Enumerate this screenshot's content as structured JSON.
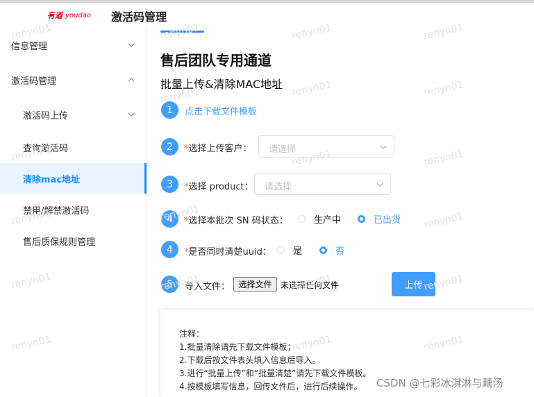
{
  "header": {
    "logo_cn": "有道",
    "logo_en": "youdao",
    "app_title": "激活码管理"
  },
  "sidebar": {
    "items": [
      {
        "label": "信息管理",
        "chevron": "down"
      },
      {
        "label": "激活码管理",
        "chevron": "up"
      },
      {
        "label": "激活码上传",
        "chevron": "down"
      },
      {
        "label": "查询激活码"
      },
      {
        "label": "清除mac地址",
        "active": true
      },
      {
        "label": "禁用/解禁激活码"
      },
      {
        "label": "售后质保规则管理"
      }
    ]
  },
  "main": {
    "title": "售后团队专用通道",
    "subtitle": "批量上传&清除MAC地址",
    "steps": [
      {
        "num": "1",
        "link": "点击下载文件模板"
      },
      {
        "num": "2",
        "req": "*",
        "label": "选择上传客户：",
        "placeholder": "请选择"
      },
      {
        "num": "3",
        "req": "*",
        "label": "选择 product：",
        "placeholder": "请选择"
      },
      {
        "num": "4",
        "req": "*",
        "label": "选择本批次 SN 码状态：",
        "options": [
          "生产中",
          "已出货"
        ],
        "selected": "已出货"
      },
      {
        "num": "4",
        "req": "*",
        "label": "是否同时清楚uuid：",
        "options": [
          "是",
          "否"
        ],
        "selected": "否"
      },
      {
        "num": "5",
        "label": "导入文件：",
        "file_button": "选择文件",
        "file_status": "未选择任何文件",
        "upload_label": "上传"
      }
    ],
    "notes": {
      "title": "注释：",
      "lines": [
        "1.批量清除请先下载文件模板；",
        "2.下载后按文件表头填入信息后导入。",
        "3.进行“批量上传”和“批量清楚”请先下载文件模板。",
        "4.按模板填写信息，回传文件后，进行后续操作。"
      ]
    }
  },
  "watermark": "renyn01",
  "csdn_watermark": "CSDN @七彩冰淇淋与藕汤",
  "colors": {
    "accent": "#409eff",
    "active_bg": "#e8f4ff",
    "required": "#f56c6c"
  }
}
